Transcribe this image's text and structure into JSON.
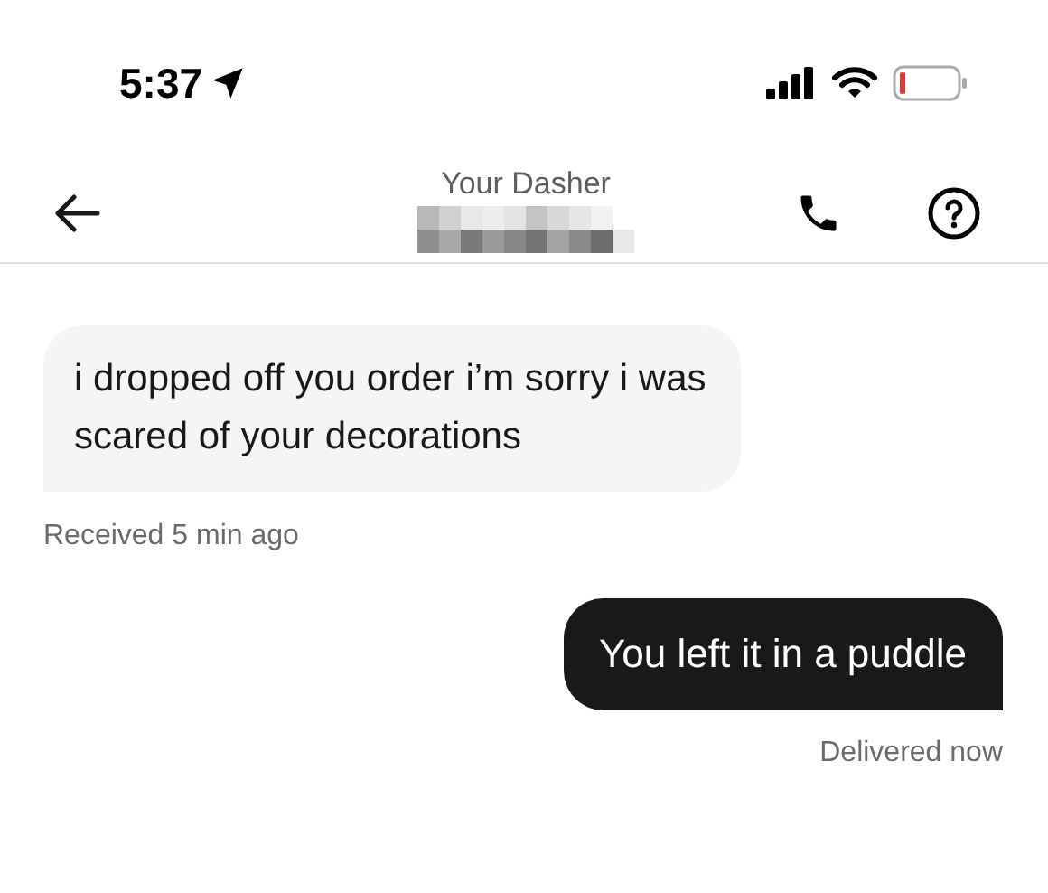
{
  "status_bar": {
    "time": "5:37"
  },
  "header": {
    "title": "Your Dasher"
  },
  "messages": [
    {
      "kind": "incoming",
      "text": "i dropped off you order i’m sorry i was scared of your decorations",
      "meta": "Received 5 min ago"
    },
    {
      "kind": "outgoing",
      "text": "You left it in a puddle",
      "meta": "Delivered now"
    }
  ]
}
